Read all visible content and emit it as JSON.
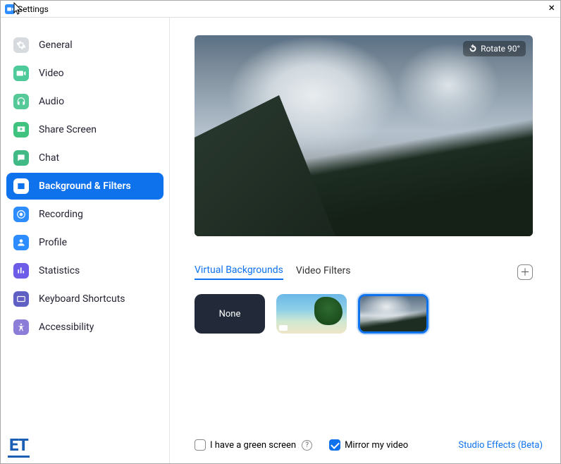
{
  "window": {
    "title": "Settings"
  },
  "sidebar": {
    "items": [
      {
        "label": "General"
      },
      {
        "label": "Video"
      },
      {
        "label": "Audio"
      },
      {
        "label": "Share Screen"
      },
      {
        "label": "Chat"
      },
      {
        "label": "Background & Filters"
      },
      {
        "label": "Recording"
      },
      {
        "label": "Profile"
      },
      {
        "label": "Statistics"
      },
      {
        "label": "Keyboard Shortcuts"
      },
      {
        "label": "Accessibility"
      }
    ]
  },
  "brand": "ET",
  "preview": {
    "rotate_label": "Rotate 90°"
  },
  "tabs": {
    "virtual_backgrounds": "Virtual Backgrounds",
    "video_filters": "Video Filters"
  },
  "thumbs": {
    "none_label": "None"
  },
  "footer": {
    "green_screen": "I have a green screen",
    "mirror": "Mirror my video",
    "studio_effects": "Studio Effects (Beta)"
  }
}
